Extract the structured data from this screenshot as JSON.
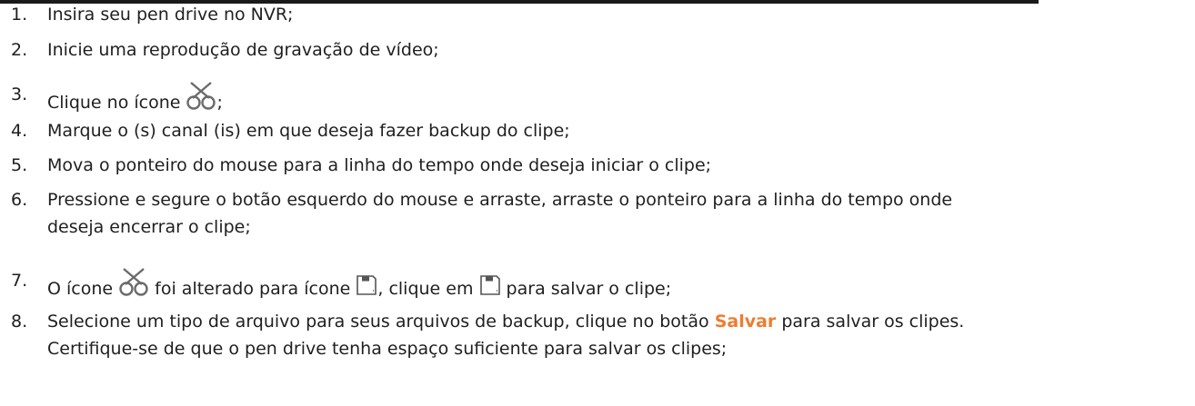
{
  "steps": [
    {
      "num": "1.",
      "text": "Insira seu pen drive no NVR;"
    },
    {
      "num": "2.",
      "text": "Inicie uma reprodução de gravação de vídeo;"
    },
    {
      "num": "3.",
      "before": "Clique no ícone ",
      "after": ";"
    },
    {
      "num": "4.",
      "text": "Marque o (s) canal (is) em que deseja fazer backup do clipe;"
    },
    {
      "num": "5.",
      "text": "Mova o ponteiro do mouse para a linha do tempo onde deseja iniciar o clipe;"
    },
    {
      "num": "6.",
      "line1": "Pressione e segure o botão esquerdo do mouse e arraste, arraste o ponteiro para a linha do tempo onde",
      "line2": "deseja encerrar o clipe;"
    },
    {
      "num": "7.",
      "part1": "O ícone ",
      "part2": " foi alterado para ícone ",
      "part3": ", clique em ",
      "part4": " para salvar o clipe;"
    },
    {
      "num": "8.",
      "line1_before": "Selecione um tipo de arquivo para seus arquivos de backup, clique no botão ",
      "button_word": "Salvar",
      "line1_after": " para salvar os clipes.",
      "line2": "Certifique-se de que o pen drive tenha espaço suficiente para salvar os clipes;"
    }
  ],
  "icons": {
    "clip": "scissors-icon",
    "save": "floppy-disk-icon"
  },
  "colors": {
    "highlight": "#ed7d31",
    "text": "#1f1f1f",
    "icon": "#6b6b6b"
  }
}
